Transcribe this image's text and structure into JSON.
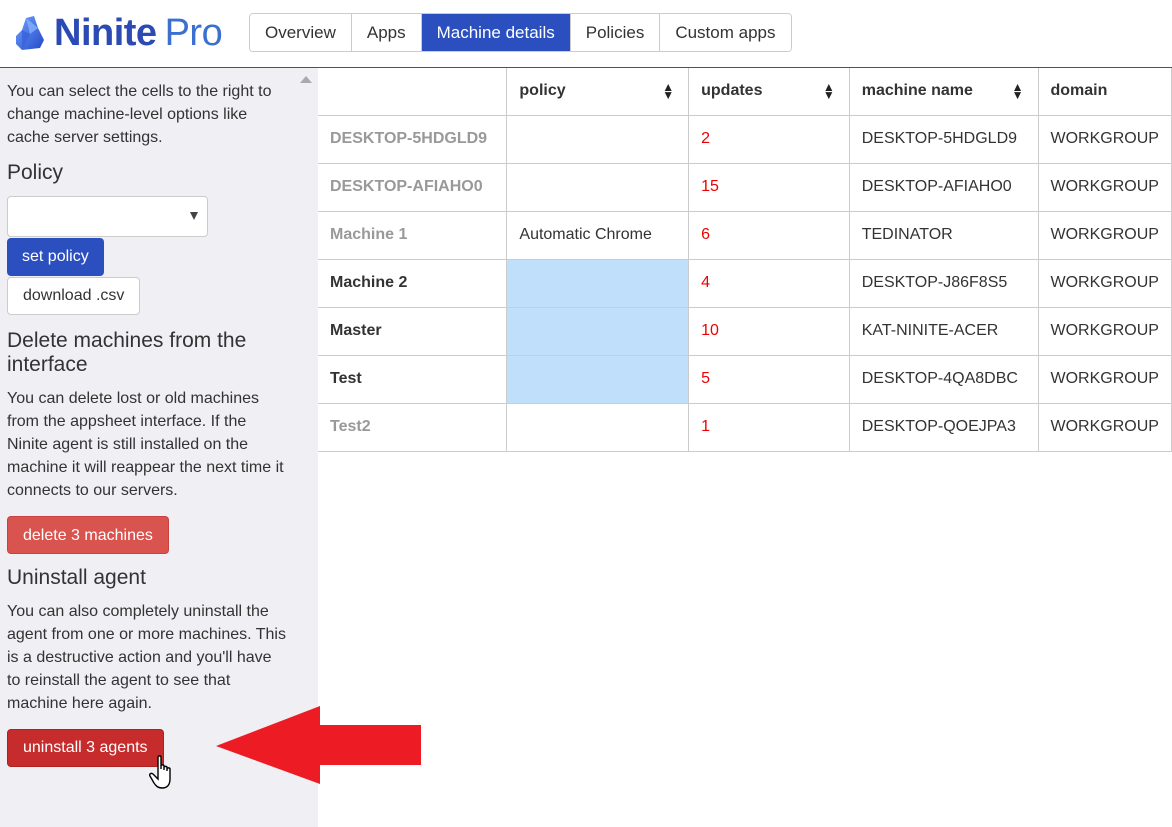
{
  "app": {
    "logo_primary": "Ninite",
    "logo_secondary": "Pro"
  },
  "tabs": [
    {
      "label": "Overview",
      "active": false
    },
    {
      "label": "Apps",
      "active": false
    },
    {
      "label": "Machine details",
      "active": true
    },
    {
      "label": "Policies",
      "active": false
    },
    {
      "label": "Custom apps",
      "active": false
    }
  ],
  "sidebar": {
    "intro": "You can select the cells to the right to change machine-level options like cache server settings.",
    "policy_heading": "Policy",
    "policy_select_value": "",
    "set_policy_label": "set policy",
    "download_label": "download .csv",
    "delete_heading": "Delete machines from the interface",
    "delete_text": "You can delete lost or old machines from the appsheet interface. If the Ninite agent is still installed on the machine it will reappear the next time it connects to our servers.",
    "delete_button": "delete 3 machines",
    "uninstall_heading": "Uninstall agent",
    "uninstall_text": "You can also completely uninstall the agent from one or more machines. This is a destructive action and you'll have to reinstall the agent to see that machine here again.",
    "uninstall_button": "uninstall 3 agents"
  },
  "table": {
    "columns": [
      "",
      "policy",
      "updates",
      "machine name",
      "domain"
    ],
    "rows": [
      {
        "name": "DESKTOP-5HDGLD9",
        "policy": "",
        "updates": "2",
        "machine_name": "DESKTOP-5HDGLD9",
        "domain": "WORKGROUP",
        "selected": false
      },
      {
        "name": "DESKTOP-AFIAHO0",
        "policy": "",
        "updates": "15",
        "machine_name": "DESKTOP-AFIAHO0",
        "domain": "WORKGROUP",
        "selected": false
      },
      {
        "name": "Machine 1",
        "policy": "Automatic Chrome",
        "updates": "6",
        "machine_name": "TEDINATOR",
        "domain": "WORKGROUP",
        "selected": false
      },
      {
        "name": "Machine 2",
        "policy": "",
        "updates": "4",
        "machine_name": "DESKTOP-J86F8S5",
        "domain": "WORKGROUP",
        "selected": true
      },
      {
        "name": "Master",
        "policy": "",
        "updates": "10",
        "machine_name": "KAT-NINITE-ACER",
        "domain": "WORKGROUP",
        "selected": true
      },
      {
        "name": "Test",
        "policy": "",
        "updates": "5",
        "machine_name": "DESKTOP-4QA8DBC",
        "domain": "WORKGROUP",
        "selected": true
      },
      {
        "name": "Test2",
        "policy": "",
        "updates": "1",
        "machine_name": "DESKTOP-QOEJPA3",
        "domain": "WORKGROUP",
        "selected": false
      }
    ]
  },
  "annotation": {
    "arrow_color": "#ed1c24",
    "arrow_points_to": "uninstall-agents-button"
  },
  "colors": {
    "brand": "#2b4fbf",
    "delete": "#d9534f",
    "uninstall": "#c72c2c",
    "updates": "#e00000",
    "selection": "#bfdffa"
  }
}
